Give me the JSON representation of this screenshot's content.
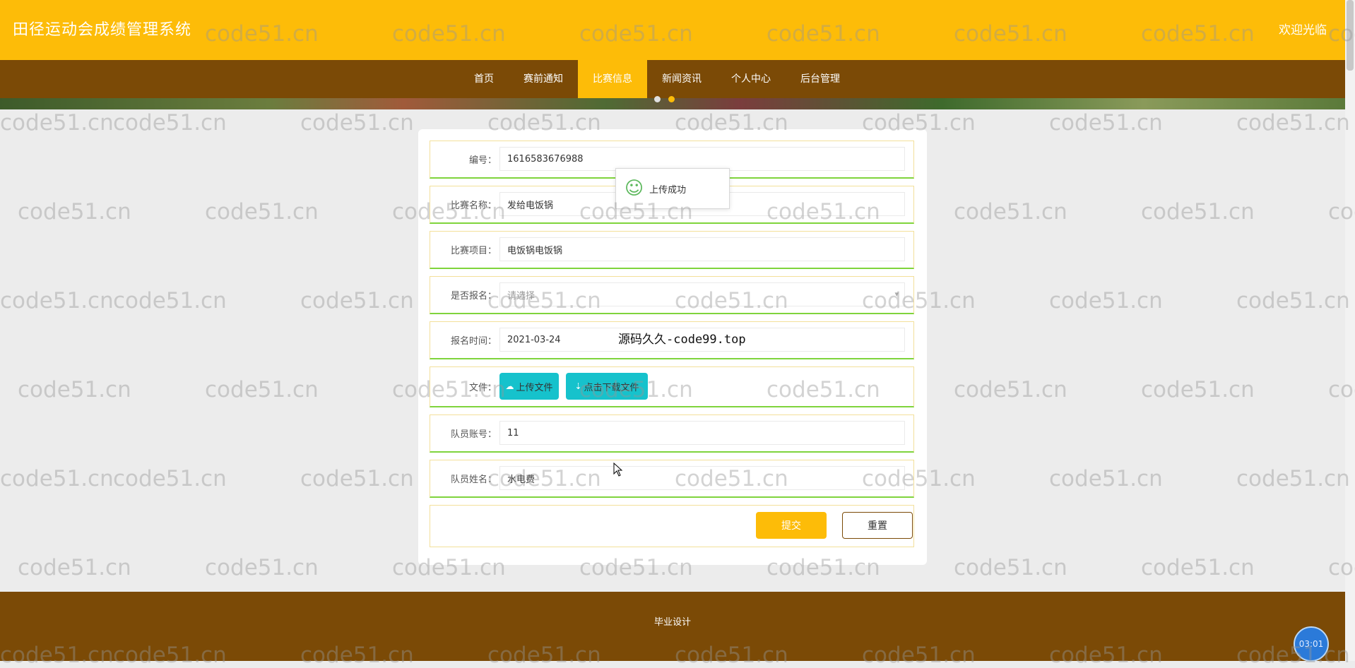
{
  "header": {
    "title": "田径运动会成绩管理系统",
    "welcome": "欢迎光临"
  },
  "nav": {
    "items": [
      {
        "label": "首页",
        "active": false
      },
      {
        "label": "赛前通知",
        "active": false
      },
      {
        "label": "比赛信息",
        "active": true
      },
      {
        "label": "新闻资讯",
        "active": false
      },
      {
        "label": "个人中心",
        "active": false
      },
      {
        "label": "后台管理",
        "active": false
      }
    ]
  },
  "form": {
    "fields": [
      {
        "label": "编号：",
        "value": "1616583676988",
        "placeholder": false
      },
      {
        "label": "比赛名称：",
        "value": "发给电饭锅",
        "placeholder": false
      },
      {
        "label": "比赛项目：",
        "value": "电饭锅电饭锅",
        "placeholder": false
      },
      {
        "label": "是否报名：",
        "value": "请选择",
        "placeholder": true,
        "select": true
      },
      {
        "label": "报名时间：",
        "value": "2021-03-24",
        "placeholder": false
      }
    ],
    "file": {
      "label": "文件：",
      "upload_label": "上传文件",
      "download_label": "点击下载文件"
    },
    "fields2": [
      {
        "label": "队员账号：",
        "value": "11"
      },
      {
        "label": "队员姓名：",
        "value": "水电费"
      }
    ],
    "submit_label": "提交",
    "reset_label": "重置"
  },
  "toast": {
    "message": "上传成功"
  },
  "overlay_text": "源码久久-code99.top",
  "footer": {
    "text": "毕业设计"
  },
  "timer": "03:01",
  "watermark": "code51.cn",
  "colors": {
    "primary": "#fdbc08",
    "nav_bg": "#7b4a06",
    "accent_button": "#16c2cc",
    "row_border": "#7fd43c"
  }
}
